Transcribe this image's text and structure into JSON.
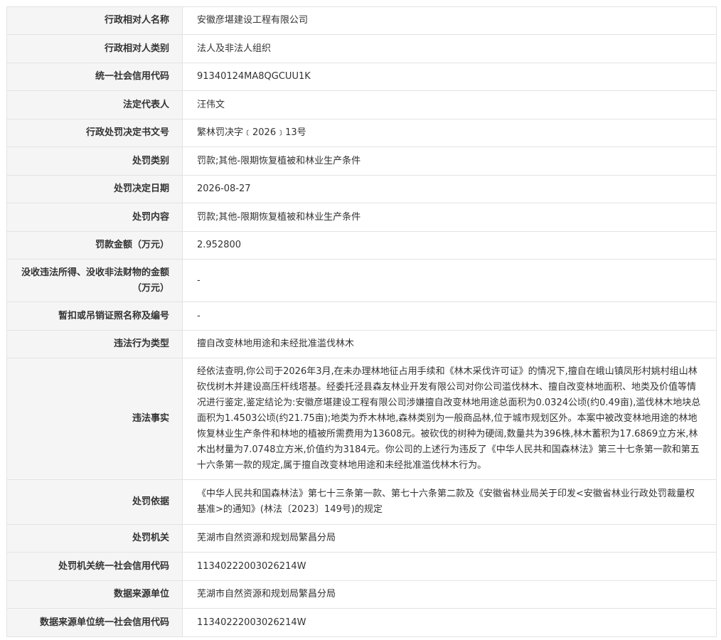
{
  "rows": [
    {
      "label": "行政相对人名称",
      "value": "安徽彦堪建设工程有限公司"
    },
    {
      "label": "行政相对人类别",
      "value": "法人及非法人组织"
    },
    {
      "label": "统一社会信用代码",
      "value": "91340124MA8QGCUU1K"
    },
    {
      "label": "法定代表人",
      "value": "汪伟文"
    },
    {
      "label": "行政处罚决定书文号",
      "value": "繁林罚决字﹝2026﹞13号"
    },
    {
      "label": "处罚类别",
      "value": "罚款;其他-限期恢复植被和林业生产条件"
    },
    {
      "label": "处罚决定日期",
      "value": "2026-08-27"
    },
    {
      "label": "处罚内容",
      "value": "罚款;其他-限期恢复植被和林业生产条件"
    },
    {
      "label": "罚款金额（万元）",
      "value": "2.952800"
    },
    {
      "label": "没收违法所得、没收非法财物的金额（万元）",
      "value": "-"
    },
    {
      "label": "暂扣或吊销证照名称及编号",
      "value": "-"
    },
    {
      "label": "违法行为类型",
      "value": "擅自改变林地用途和未经批准滥伐林木"
    },
    {
      "label": "违法事实",
      "value": "经依法查明,你公司于2026年3月,在未办理林地征占用手续和《林木采伐许可证》的情况下,擅自在峨山镇凤形村姚村组山林砍伐树木并建设高压杆线塔基。经委托泾县森友林业开发有限公司对你公司滥伐林木、擅自改变林地面积、地类及价值等情况进行鉴定,鉴定结论为:安徽彦堪建设工程有限公司涉嫌擅自改变林地用途总面积为0.0324公顷(约0.49亩),滥伐林木地块总面积为1.4503公顷(约21.75亩);地类为乔木林地,森林类别为一般商品林,位于城市规划区外。本案中被改变林地用途的林地恢复林业生产条件和林地的植被所需费用为13608元。被砍伐的树种为硬阔,数量共为396株,林木蓄积为17.6869立方米,林木出材量为7.0748立方米,价值约为3184元。你公司的上述行为违反了《中华人民共和国森林法》第三十七条第一款和第五十六条第一款的规定,属于擅自改变林地用途和未经批准滥伐林木行为。"
    },
    {
      "label": "处罚依据",
      "value": "《中华人民共和国森林法》第七十三条第一款、第七十六条第二款及《安徽省林业局关于印发<安徽省林业行政处罚裁量权基准>的通知》(林法〔2023〕149号)的规定"
    },
    {
      "label": "处罚机关",
      "value": "芜湖市自然资源和规划局繁昌分局"
    },
    {
      "label": "处罚机关统一社会信用代码",
      "value": "11340222003026214W"
    },
    {
      "label": "数据来源单位",
      "value": "芜湖市自然资源和规划局繁昌分局"
    },
    {
      "label": "数据来源单位统一社会信用代码",
      "value": "11340222003026214W"
    }
  ]
}
